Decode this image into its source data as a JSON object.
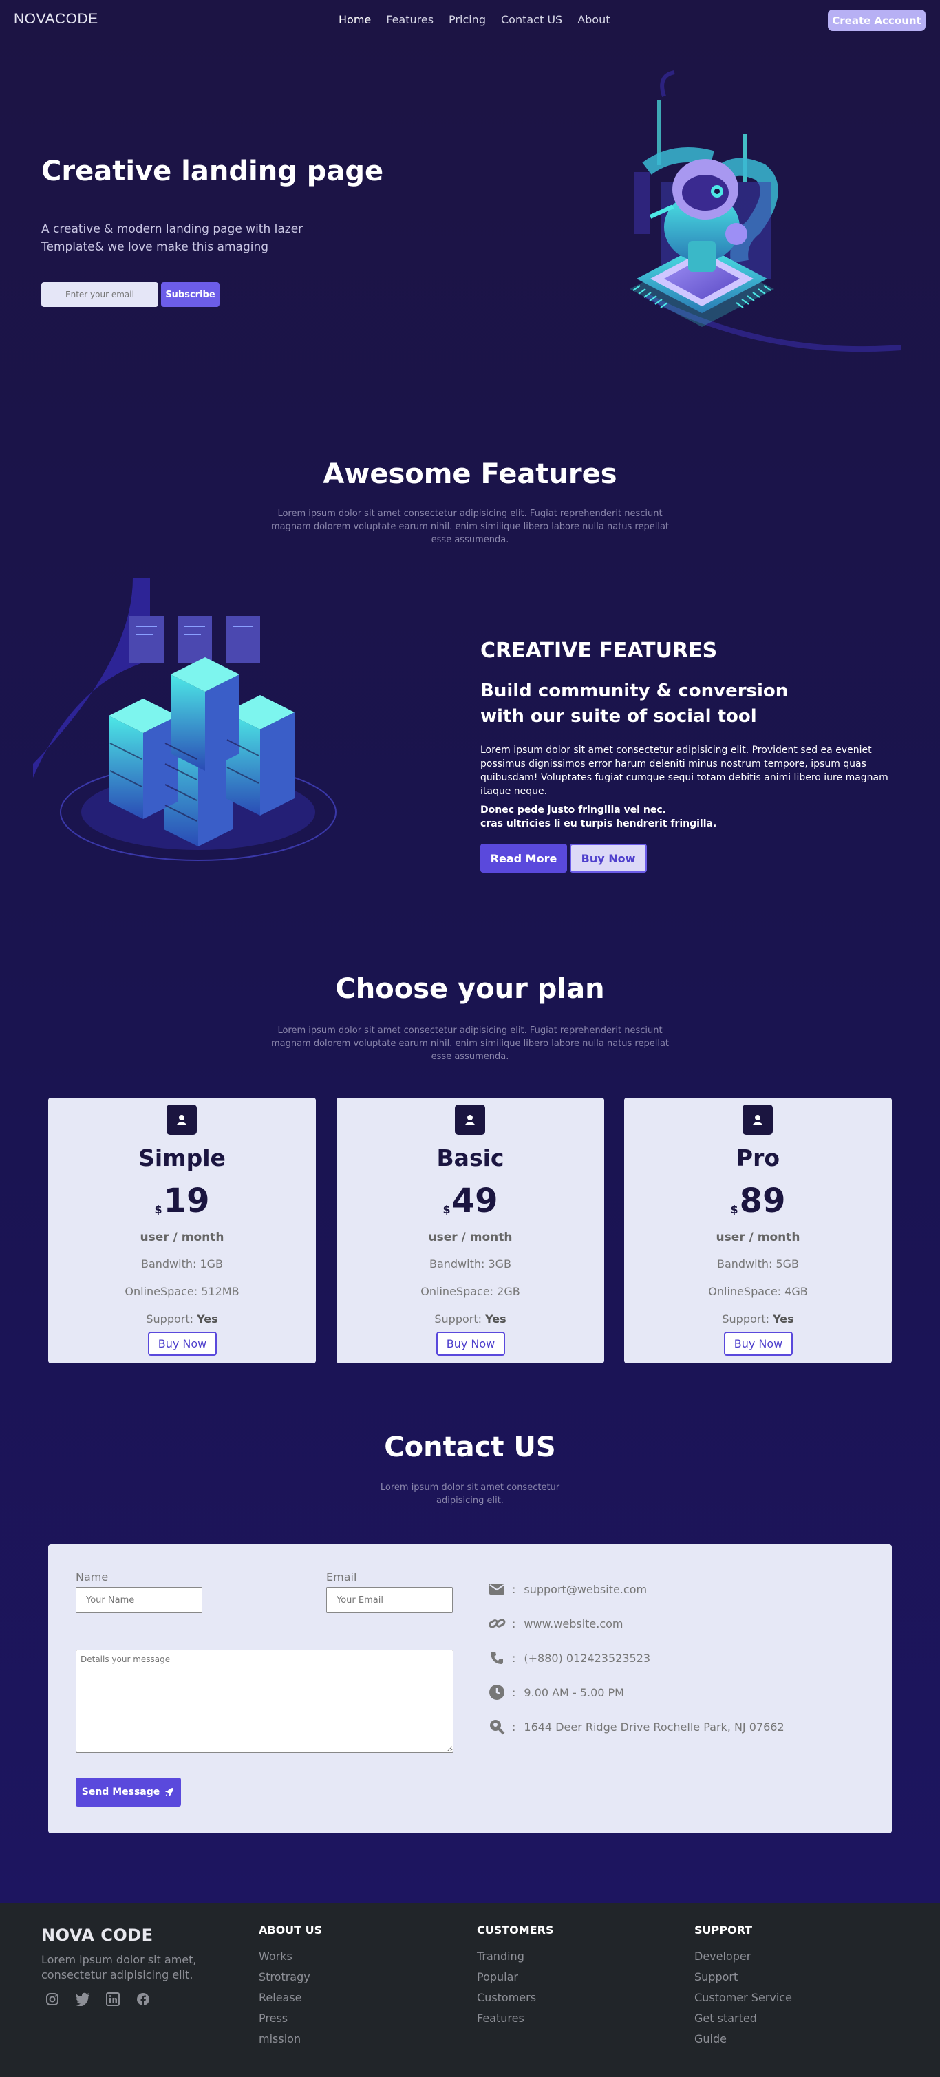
{
  "nav": {
    "logo": "NOVACODE",
    "links": [
      "Home",
      "Features",
      "Pricing",
      "Contact US",
      "About"
    ],
    "cta": "Create Account"
  },
  "hero": {
    "title": "Creative landing page",
    "subtitle": "A creative & modern landing page with lazer Template& we love make this amaging",
    "email_placeholder": "Enter your email",
    "subscribe": "Subscribe"
  },
  "features": {
    "title": "Awesome Features",
    "description": "Lorem ipsum dolor sit amet consectetur adipisicing elit. Fugiat reprehenderit nesciunt magnam dolorem voluptate earum nihil. enim similique libero labore nulla natus repellat esse assumenda.",
    "label": "CREATIVE FEATURES",
    "heading": "Build community & conversion with our suite of social tool",
    "paragraph": "Lorem ipsum dolor sit amet consectetur adipisicing elit. Provident sed ea eveniet possimus dignissimos error harum deleniti minus nostrum tempore, ipsum quas quibusdam! Voluptates fugiat cumque sequi totam debitis animi libero iure magnam itaque neque.",
    "bold_line1": "Donec pede justo fringilla vel nec.",
    "bold_line2": "cras ultricies li eu turpis hendrerit fringilla.",
    "read_more": "Read More",
    "buy_now": "Buy Now"
  },
  "pricing": {
    "title": "Choose your plan",
    "description": "Lorem ipsum dolor sit amet consectetur adipisicing elit. Fugiat reprehenderit nesciunt magnam dolorem voluptate earum nihil. enim similique libero labore nulla natus repellat esse assumenda.",
    "currency": "$",
    "unit": "user / month",
    "bandwidth_label": "Bandwith: ",
    "space_label": "OnlineSpace: ",
    "support_label": "Support: ",
    "plans": [
      {
        "name": "Simple",
        "price": "19",
        "bandwidth": "1GB",
        "space": "512MB",
        "support": "Yes",
        "button": "Buy Now"
      },
      {
        "name": "Basic",
        "price": "49",
        "bandwidth": "3GB",
        "space": "2GB",
        "support": "Yes",
        "button": "Buy Now"
      },
      {
        "name": "Pro",
        "price": "89",
        "bandwidth": "5GB",
        "space": "4GB",
        "support": "Yes",
        "button": "Buy Now"
      }
    ]
  },
  "contact": {
    "title": "Contact US",
    "description": "Lorem ipsum dolor sit amet consectetur adipisicing elit.",
    "name_label": "Name",
    "name_placeholder": "Your Name",
    "email_label": "Email",
    "email_placeholder": "Your Email",
    "message_placeholder": "Details your message",
    "send": "Send Message",
    "sep": ":",
    "info": [
      {
        "icon": "envelope-icon",
        "text": "support@website.com"
      },
      {
        "icon": "link-icon",
        "text": "www.website.com"
      },
      {
        "icon": "phone-icon",
        "text": "(+880) 012423523523"
      },
      {
        "icon": "clock-icon",
        "text": "9.00 AM - 5.00 PM"
      },
      {
        "icon": "location-search-icon",
        "text": "1644 Deer Ridge Drive Rochelle Park, NJ 07662"
      }
    ]
  },
  "footer": {
    "brand": "NOVA CODE",
    "description": "Lorem ipsum dolor sit amet, consectetur adipisicing elit.",
    "social": [
      "instagram-icon",
      "twitter-icon",
      "linkedin-icon",
      "facebook-icon"
    ],
    "columns": [
      {
        "title": "ABOUT US",
        "links": [
          "Works",
          "Strotragy",
          "Release",
          "Press",
          "mission"
        ]
      },
      {
        "title": "CUSTOMERS",
        "links": [
          "Tranding",
          "Popular",
          "Customers",
          "Features"
        ]
      },
      {
        "title": "SUPPORT",
        "links": [
          "Developer",
          "Support",
          "Customer Service",
          "Get started",
          "Guide"
        ]
      }
    ]
  },
  "colors": {
    "background": "#1c1444",
    "accent": "#5a49dc",
    "card": "#e6e8f6",
    "footer": "#212529",
    "teal": "#3ff0e0"
  }
}
